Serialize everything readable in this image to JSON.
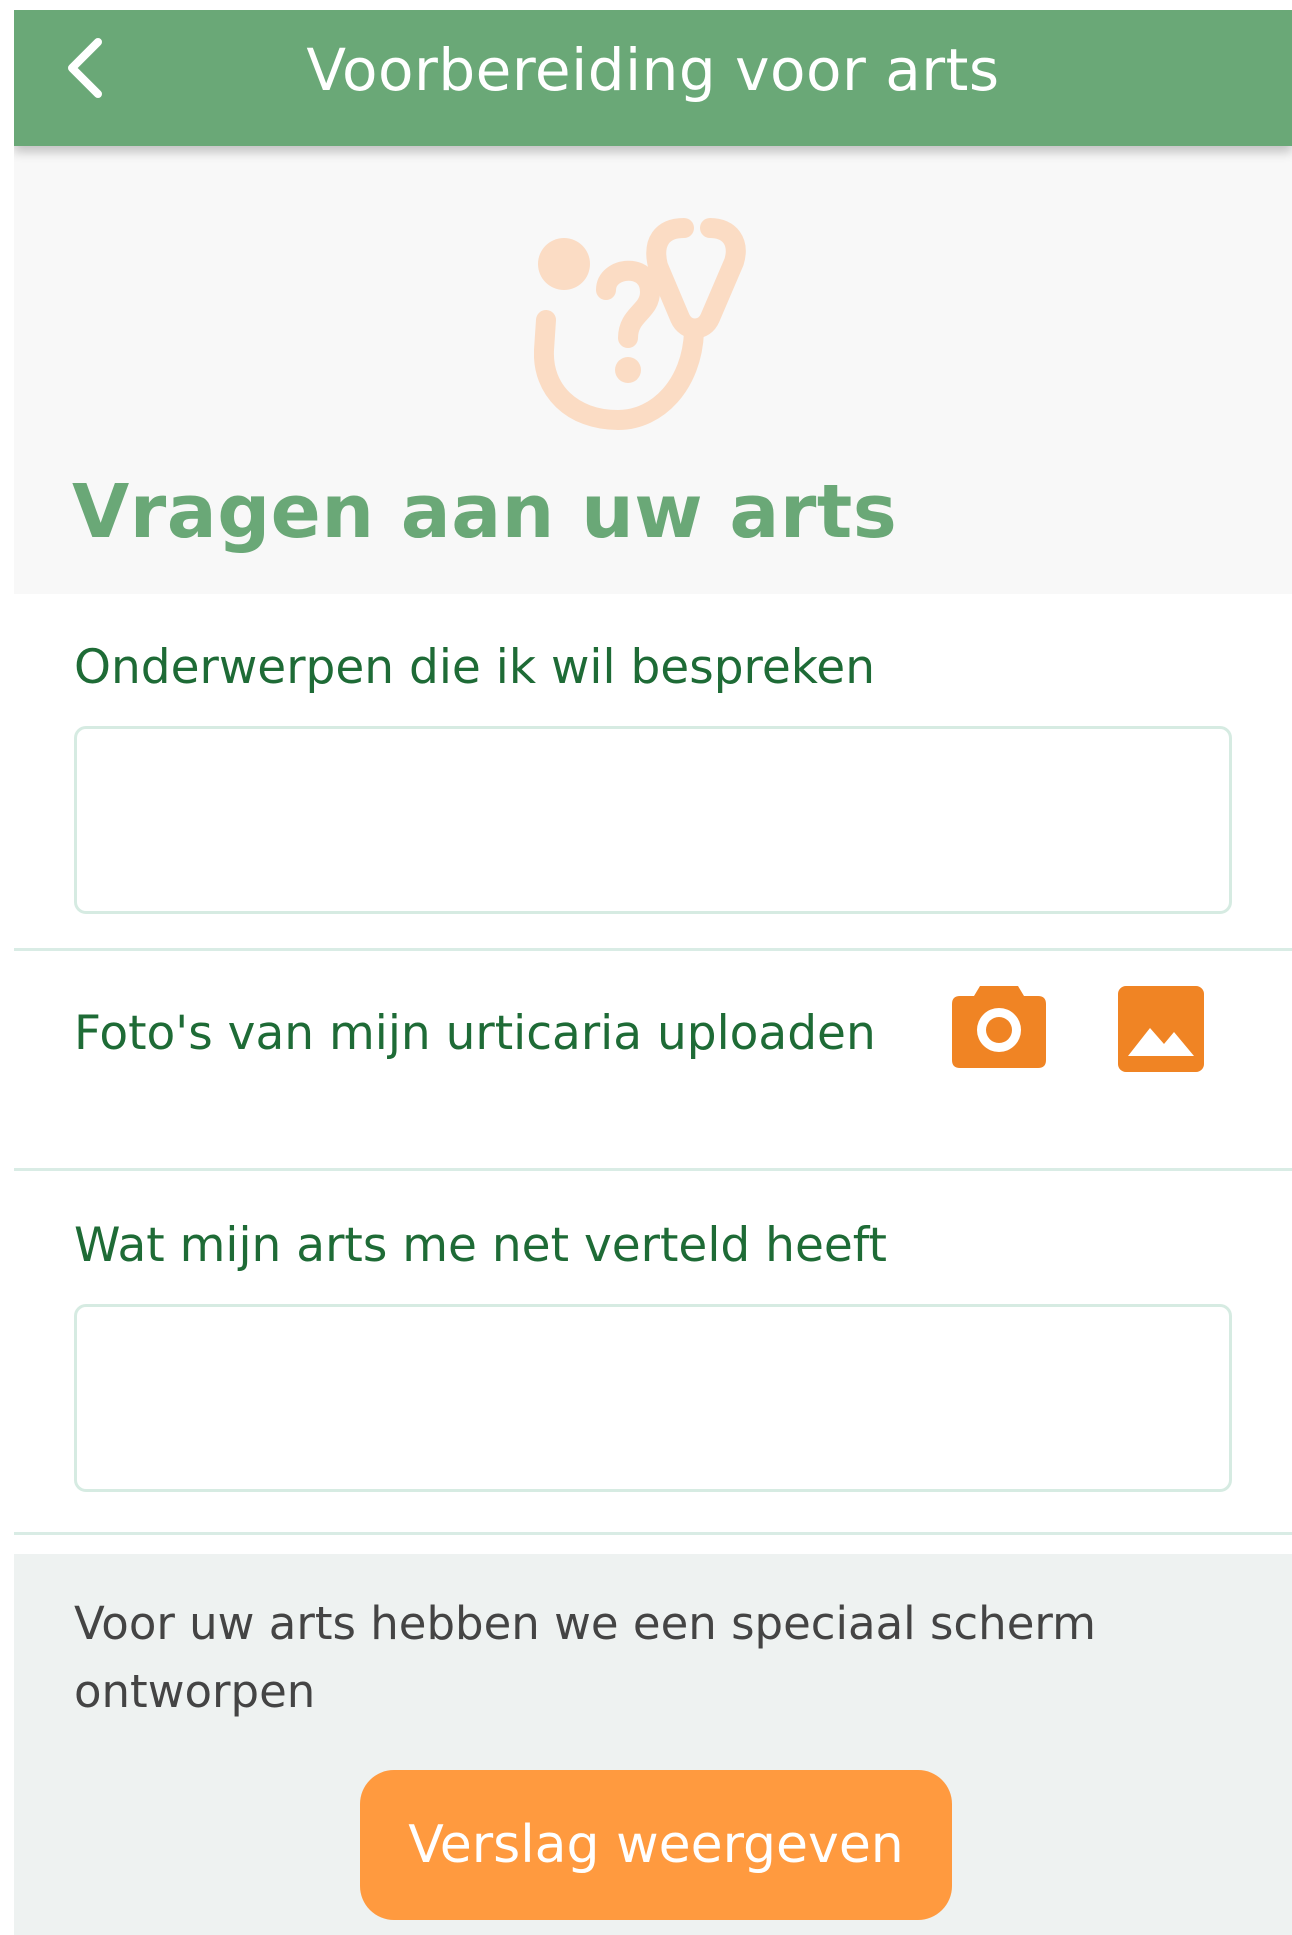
{
  "header": {
    "title": "Voorbereiding voor arts",
    "back_icon": "chevron-left-icon"
  },
  "hero": {
    "icon": "stethoscope-question-icon",
    "title": "Vragen aan uw arts"
  },
  "form": {
    "topics": {
      "label": "Onderwerpen die ik wil bespreken",
      "value": "",
      "placeholder": ""
    },
    "photos": {
      "label": "Foto's van mijn urticaria uploaden",
      "camera_icon": "camera-icon",
      "gallery_icon": "image-gallery-icon"
    },
    "doctor_notes": {
      "label": "Wat mijn arts me net verteld heeft",
      "value": "",
      "placeholder": ""
    }
  },
  "footer": {
    "text": "Voor uw arts hebben we een speciaal scherm ontworpen",
    "button_label": "Verslag weergeven"
  },
  "colors": {
    "header_green": "#6aa877",
    "label_green": "#1e6b36",
    "accent_orange": "#f08424",
    "button_orange": "#ff9a3f",
    "hero_icon_peach": "#fbdcc4"
  }
}
